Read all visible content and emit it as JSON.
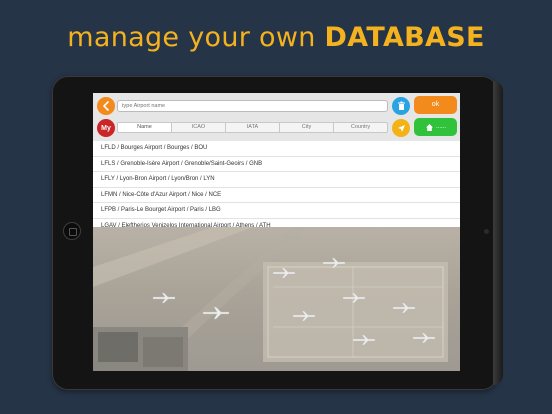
{
  "headline": {
    "light": "manage your own",
    "bold": "DATABASE"
  },
  "toolbar": {
    "search_placeholder": "type Airport name",
    "ok_label": "ok",
    "my_label": "My",
    "green_label": "......",
    "segments": [
      "Name",
      "ICAO",
      "IATA",
      "City",
      "Country"
    ],
    "selected_segment": "Name"
  },
  "airports": [
    "LFLD / Bourges Airport / Bourges / BOU",
    "LFLS / Grenoble-Isère Airport / Grenoble/Saint-Geoirs / GNB",
    "LFLY / Lyon-Bron Airport / Lyon/Bron / LYN",
    "LFMN / Nice-Côte d'Azur Airport / Nice / NCE",
    "LFPB / Paris-Le Bourget Airport / Paris / LBG",
    "LGAV / Eleftherios Venizelos International Airport / Athens / ATH"
  ],
  "colors": {
    "background": "#263447",
    "headline": "#f4b21f",
    "orange": "#f28a1c",
    "red": "#c9262a",
    "blue": "#2aa3e2",
    "yellow": "#f2b316",
    "green": "#30c23a"
  },
  "icons": {
    "back": "chevron-left-icon",
    "trash": "trash-icon",
    "locate": "location-arrow-icon",
    "home": "home-icon"
  }
}
